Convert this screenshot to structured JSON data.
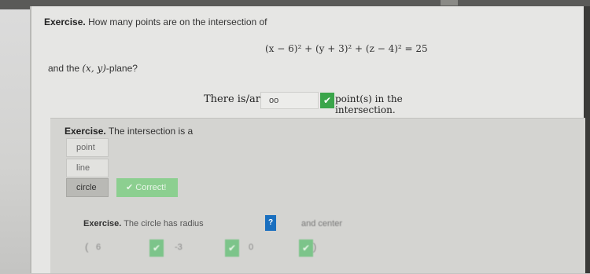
{
  "exercise1": {
    "title": "Exercise.",
    "question": "How many points are on the intersection of",
    "equation": "(x − 6)² + (y + 3)² + (z − 4)² = 25",
    "and_text_pre": "and the ",
    "and_text_math": "(x, y)",
    "and_text_post": "-plane?",
    "answer_prefix": "There is/are",
    "answer_value": "oo",
    "answer_suffix": "point(s) in the intersection.",
    "answer_status_icon": "check-icon"
  },
  "exercise2": {
    "title": "Exercise.",
    "question": "The intersection is a",
    "options": [
      "point",
      "line",
      "circle"
    ],
    "selected": "circle",
    "correct_label": "✔ Correct!"
  },
  "exercise3": {
    "title": "Exercise.",
    "question": "The circle has radius",
    "help_label": "?",
    "center_label": "and center",
    "open_paren": "(",
    "close_paren": ")",
    "center_values": [
      "6",
      "-3",
      "0"
    ]
  },
  "colors": {
    "correct_green": "#3aa54a",
    "correct_button_green": "#8ccf90",
    "help_blue": "#1a6fbf"
  }
}
